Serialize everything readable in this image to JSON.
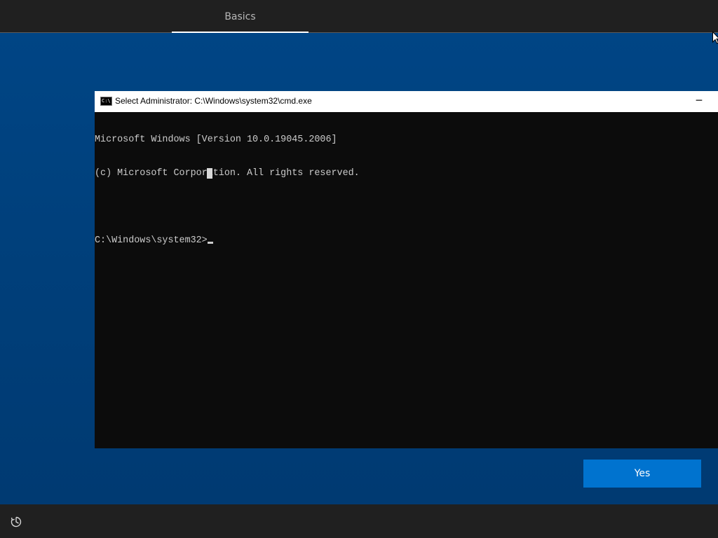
{
  "header": {
    "tab_label": "Basics"
  },
  "cmd_window": {
    "icon_text": "C:\\",
    "title": "Select Administrator: C:\\Windows\\system32\\cmd.exe",
    "minimize_glyph": "─",
    "console_lines": [
      "Microsoft Windows [Version 10.0.19045.2006]",
      "(c) Microsoft Corporation. All rights reserved.",
      "",
      "C:\\Windows\\system32>"
    ]
  },
  "actions": {
    "yes_label": "Yes"
  },
  "footer": {
    "accessibility_icon": "accessibility-icon"
  },
  "colors": {
    "background_blue": "#003e78",
    "bar_dark": "#202020",
    "button_blue": "#0073cf",
    "console_bg": "#0c0c0c",
    "console_text": "#cccccc"
  }
}
